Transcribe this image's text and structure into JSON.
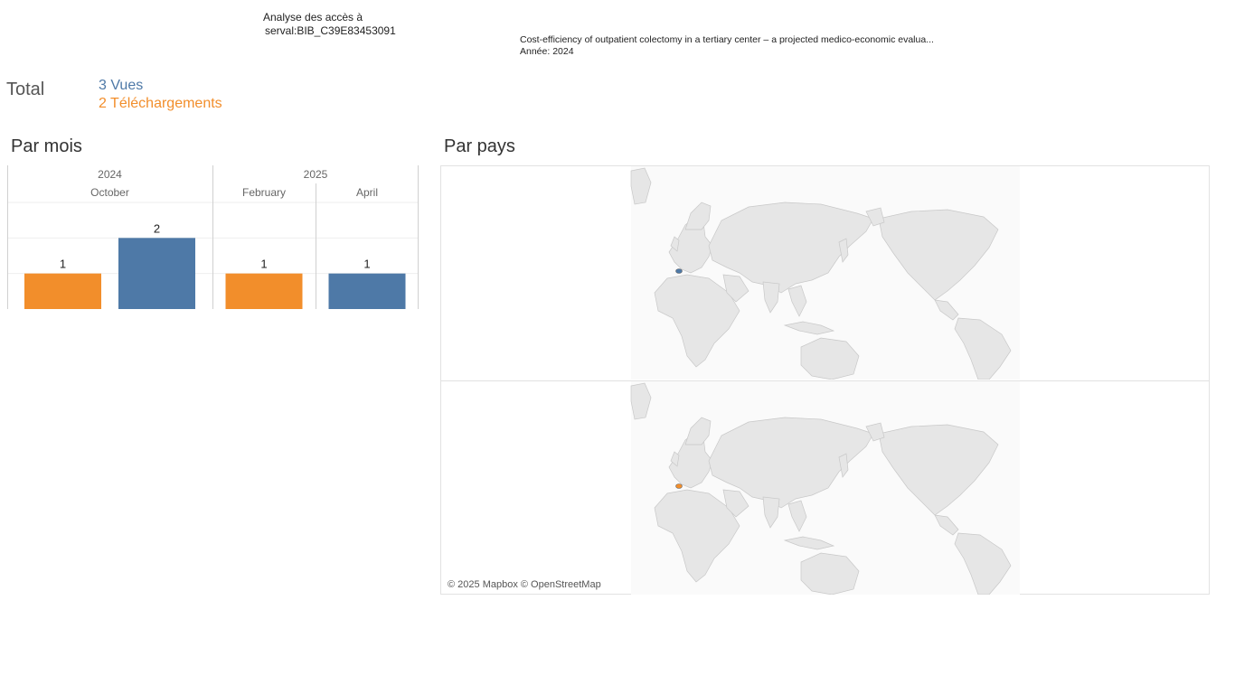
{
  "header": {
    "title_line1": "Analyse des accès à",
    "title_line2": "serval:BIB_C39E83453091",
    "doc_title": "Cost-efficiency of outpatient colectomy in a tertiary center – a projected medico-economic evalua...",
    "doc_year": "Année: 2024"
  },
  "totals": {
    "label": "Total",
    "views": "3 Vues",
    "downloads": "2 Téléchargements"
  },
  "by_month": {
    "title": "Par mois"
  },
  "by_country": {
    "title": "Par pays",
    "credit": "© 2025 Mapbox © OpenStreetMap",
    "markers": [
      {
        "panel": "views",
        "country": "Switzerland",
        "color": "#4e79a7"
      },
      {
        "panel": "downloads",
        "country": "Switzerland",
        "color": "#f28e2b"
      }
    ]
  },
  "colors": {
    "views": "#4e79a7",
    "downloads": "#f28e2b",
    "map_land": "#e6e6e6",
    "map_border": "#c8c8c8"
  },
  "chart_data": {
    "type": "bar",
    "years": [
      "2024",
      "2025"
    ],
    "months": [
      {
        "year": "2024",
        "month": "October"
      },
      {
        "year": "2025",
        "month": "February"
      },
      {
        "year": "2025",
        "month": "April"
      }
    ],
    "series": [
      {
        "name": "Téléchargements",
        "color": "#f28e2b",
        "values": [
          1,
          1,
          0
        ]
      },
      {
        "name": "Vues",
        "color": "#4e79a7",
        "values": [
          2,
          0,
          1
        ]
      }
    ],
    "ylim": [
      0,
      3
    ],
    "grid": true
  }
}
